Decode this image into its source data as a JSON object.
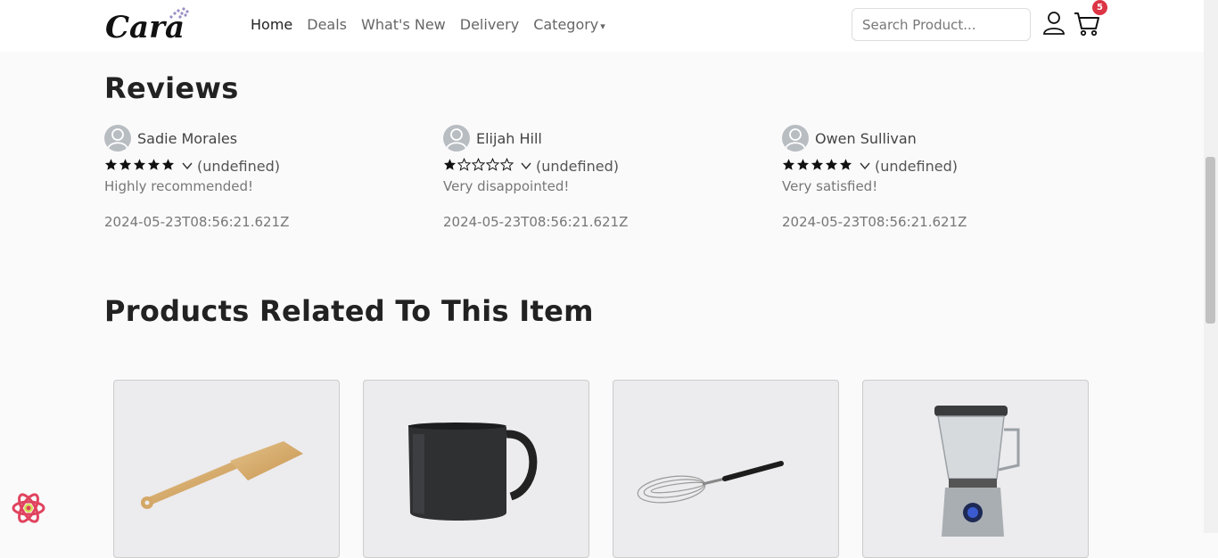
{
  "brand": {
    "name": "Cara"
  },
  "nav": {
    "items": [
      {
        "label": "Home",
        "active": true
      },
      {
        "label": "Deals",
        "active": false
      },
      {
        "label": "What's New",
        "active": false
      },
      {
        "label": "Delivery",
        "active": false
      },
      {
        "label": "Category",
        "active": false
      }
    ],
    "caret": "▾"
  },
  "search": {
    "placeholder": "Search Product..."
  },
  "cart": {
    "count": "5"
  },
  "reviews": {
    "title": "Reviews",
    "items": [
      {
        "name": "Sadie Morales",
        "rating": 5,
        "count": "(undefined)",
        "text": "Highly recommended!",
        "date": "2024-05-23T08:56:21.621Z"
      },
      {
        "name": "Elijah Hill",
        "rating": 1,
        "count": "(undefined)",
        "text": "Very disappointed!",
        "date": "2024-05-23T08:56:21.621Z"
      },
      {
        "name": "Owen Sullivan",
        "rating": 5,
        "count": "(undefined)",
        "text": "Very satisfied!",
        "date": "2024-05-23T08:56:21.621Z"
      }
    ]
  },
  "related": {
    "title": "Products Related To This Item",
    "products": [
      {
        "image": "wooden-spatula"
      },
      {
        "image": "black-mug"
      },
      {
        "image": "wire-whisk"
      },
      {
        "image": "blender"
      }
    ]
  },
  "colors": {
    "accent": "#dc3545",
    "text": "#222222",
    "muted": "#777777"
  }
}
